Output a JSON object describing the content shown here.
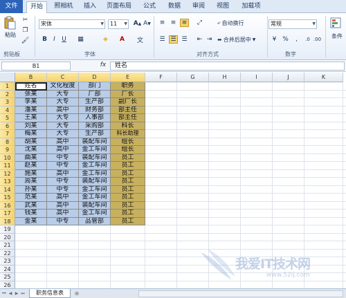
{
  "ribbon": {
    "tabs": [
      "文件",
      "开始",
      "照相机",
      "插入",
      "页面布局",
      "公式",
      "数据",
      "审阅",
      "视图",
      "加载项"
    ],
    "active_tab": 1,
    "groups": {
      "clipboard": "剪贴板",
      "font": "字体",
      "alignment": "对齐方式",
      "number": "数字"
    },
    "paste_label": "粘贴",
    "font_name": "宋体",
    "font_size": "11",
    "wrap_text": "自动换行",
    "merge_center": "合并后居中",
    "number_format": "常规",
    "conditional_format": "条件"
  },
  "formula_bar": {
    "name_box": "B1",
    "fx": "fx",
    "content": "姓名"
  },
  "grid": {
    "columns": [
      "B",
      "C",
      "D",
      "E",
      "F",
      "G",
      "H",
      "I",
      "J",
      "K"
    ],
    "rows": [
      "1",
      "2",
      "3",
      "4",
      "5",
      "6",
      "7",
      "8",
      "9",
      "10",
      "11",
      "12",
      "13",
      "14",
      "15",
      "16",
      "17",
      "18",
      "19",
      "20",
      "21",
      "22",
      "23",
      "24",
      "25",
      "26"
    ],
    "table": [
      [
        "姓名",
        "文化程度",
        "部门",
        "职务"
      ],
      [
        "张某",
        "大专",
        "厂部",
        "厂长"
      ],
      [
        "李某",
        "大专",
        "生产部",
        "副厂长"
      ],
      [
        "潘某",
        "高中",
        "财务部",
        "部主任"
      ],
      [
        "王某",
        "大专",
        "人事部",
        "部主任"
      ],
      [
        "刘某",
        "大专",
        "采购部",
        "科长"
      ],
      [
        "梅某",
        "大专",
        "生产部",
        "科长助理"
      ],
      [
        "胡某",
        "高中",
        "装配车间",
        "组长"
      ],
      [
        "沈某",
        "高中",
        "金工车间",
        "组长"
      ],
      [
        "曲某",
        "中专",
        "装配车间",
        "员工"
      ],
      [
        "赵某",
        "中专",
        "金工车间",
        "员工"
      ],
      [
        "施某",
        "高中",
        "金工车间",
        "员工"
      ],
      [
        "周某",
        "中专",
        "装配车间",
        "员工"
      ],
      [
        "孙某",
        "中专",
        "金工车间",
        "员工"
      ],
      [
        "范某",
        "高中",
        "金工车间",
        "员工"
      ],
      [
        "武某",
        "高中",
        "装配车间",
        "员工"
      ],
      [
        "钱某",
        "高中",
        "金工车间",
        "员工"
      ],
      [
        "金某",
        "中专",
        "品管部",
        "员工"
      ]
    ]
  },
  "sheet_tab": "职务信息表",
  "watermark": {
    "text": "我爱IT技术网",
    "url": "www.52ij.com"
  }
}
